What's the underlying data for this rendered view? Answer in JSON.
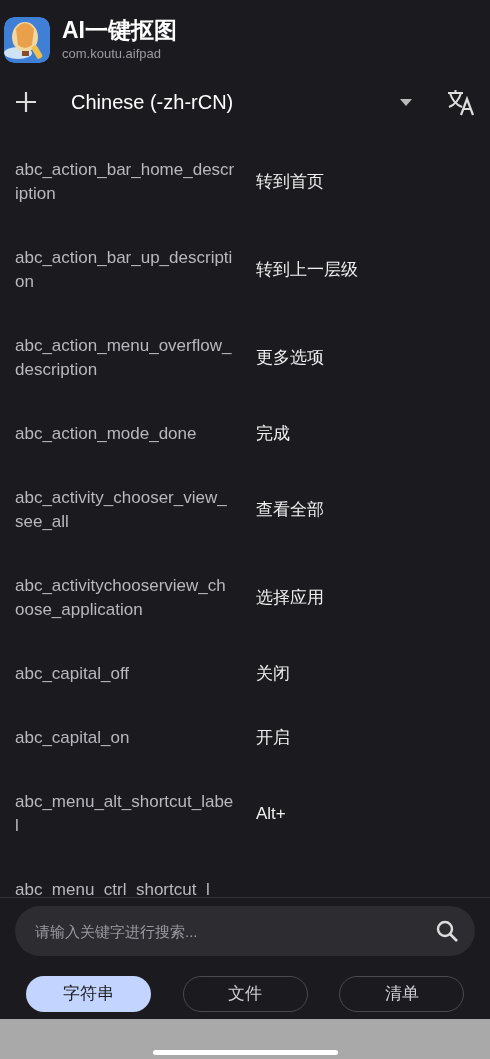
{
  "app": {
    "name": "AI一键抠图",
    "package": "com.koutu.aifpad"
  },
  "language": {
    "label": "Chinese (-zh-rCN)"
  },
  "strings": [
    {
      "key": "abc_action_bar_home_description",
      "value": "转到首页"
    },
    {
      "key": "abc_action_bar_up_description",
      "value": "转到上一层级"
    },
    {
      "key": "abc_action_menu_overflow_description",
      "value": "更多选项"
    },
    {
      "key": "abc_action_mode_done",
      "value": "完成"
    },
    {
      "key": "abc_activity_chooser_view_see_all",
      "value": "查看全部"
    },
    {
      "key": "abc_activitychooserview_choose_application",
      "value": "选择应用"
    },
    {
      "key": "abc_capital_off",
      "value": "关闭"
    },
    {
      "key": "abc_capital_on",
      "value": "开启"
    },
    {
      "key": "abc_menu_alt_shortcut_label",
      "value": "Alt+"
    },
    {
      "key": "abc_menu_ctrl_shortcut_l"
    }
  ],
  "search": {
    "placeholder": "请输入关键字进行搜索..."
  },
  "tabs": [
    {
      "label": "字符串",
      "selected": true
    },
    {
      "label": "文件",
      "selected": false
    },
    {
      "label": "清单",
      "selected": false
    }
  ]
}
